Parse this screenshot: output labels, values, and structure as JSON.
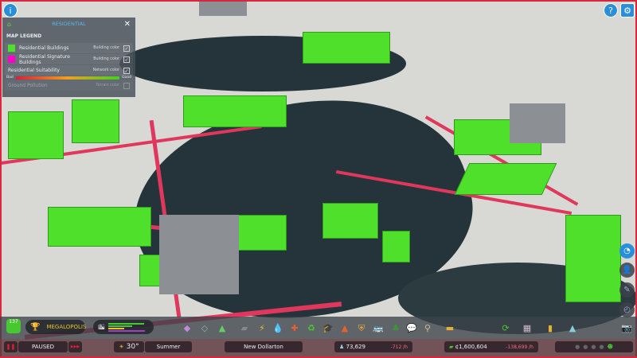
{
  "legend": {
    "title": "RESIDENTIAL",
    "section": "MAP LEGEND",
    "items": [
      {
        "label": "Residential Buildings",
        "mode": "Building color",
        "checked": true,
        "color": "#4fe02c"
      },
      {
        "label": "Residential Signature Buildings",
        "mode": "Building color",
        "checked": true,
        "color": "#ff00cc"
      },
      {
        "label": "Residential Suitability",
        "mode": "Network color",
        "checked": true
      },
      {
        "label": "Ground Pollution",
        "mode": "Terrain color",
        "checked": false
      }
    ],
    "scale_low": "Bad",
    "scale_high": "Good"
  },
  "milestone": {
    "level": "137",
    "name": "MEGALOPOLIS"
  },
  "sim": {
    "status": "PAUSED"
  },
  "weather": {
    "temp": "30°",
    "season": "Summer"
  },
  "city": {
    "name": "New Dollarton"
  },
  "population": {
    "value": "73,629",
    "rate": "-712 /h"
  },
  "money": {
    "value": "¢1,600,604",
    "rate": "-138,699 /h"
  },
  "toolbar_icons": [
    "zoning-icon",
    "area-icon",
    "landscaping-icon",
    "roads-icon",
    "electricity-icon",
    "water-icon",
    "healthcare-icon",
    "garbage-icon",
    "education-icon",
    "fire-icon",
    "police-icon",
    "transport-icon",
    "parks-icon",
    "communications-icon",
    "landmarks-icon",
    "bulldoze-icon",
    "progression-icon",
    "info-views-icon",
    "statistics-icon",
    "economy-icon"
  ],
  "colors": {
    "accent": "#2a8fd8",
    "residential": "#4fe02c",
    "road_low": "#e0375c"
  }
}
